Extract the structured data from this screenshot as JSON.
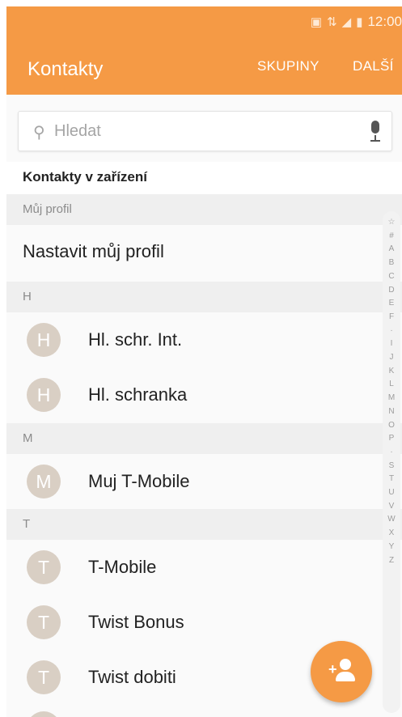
{
  "status_bar": {
    "time": "12:00",
    "icons": [
      "nfc-icon",
      "lte-icon",
      "signal-icon",
      "battery-icon"
    ]
  },
  "header": {
    "title": "Kontakty",
    "actions": [
      "SKUPINY",
      "DALŠÍ"
    ]
  },
  "search": {
    "placeholder": "Hledat"
  },
  "section_title": "Kontakty v zařízení",
  "profile": {
    "group_label": "Můj profil",
    "setup_label": "Nastavit můj profil"
  },
  "groups": [
    {
      "letter": "H",
      "contacts": [
        {
          "initial": "H",
          "name": "Hl. schr. Int."
        },
        {
          "initial": "H",
          "name": "Hl. schranka"
        }
      ]
    },
    {
      "letter": "M",
      "contacts": [
        {
          "initial": "M",
          "name": "Muj T-Mobile"
        }
      ]
    },
    {
      "letter": "T",
      "contacts": [
        {
          "initial": "T",
          "name": "T-Mobile"
        },
        {
          "initial": "T",
          "name": "Twist Bonus"
        },
        {
          "initial": "T",
          "name": "Twist dobiti"
        }
      ]
    }
  ],
  "index_letters": [
    "☆",
    "#",
    "A",
    "B",
    "C",
    "D",
    "E",
    "F",
    "·",
    "I",
    "J",
    "K",
    "L",
    "M",
    "N",
    "O",
    "P",
    "·",
    "S",
    "T",
    "U",
    "V",
    "W",
    "X",
    "Y",
    "Z"
  ],
  "colors": {
    "accent": "#f59a45",
    "avatar": "#d9cfc4"
  }
}
